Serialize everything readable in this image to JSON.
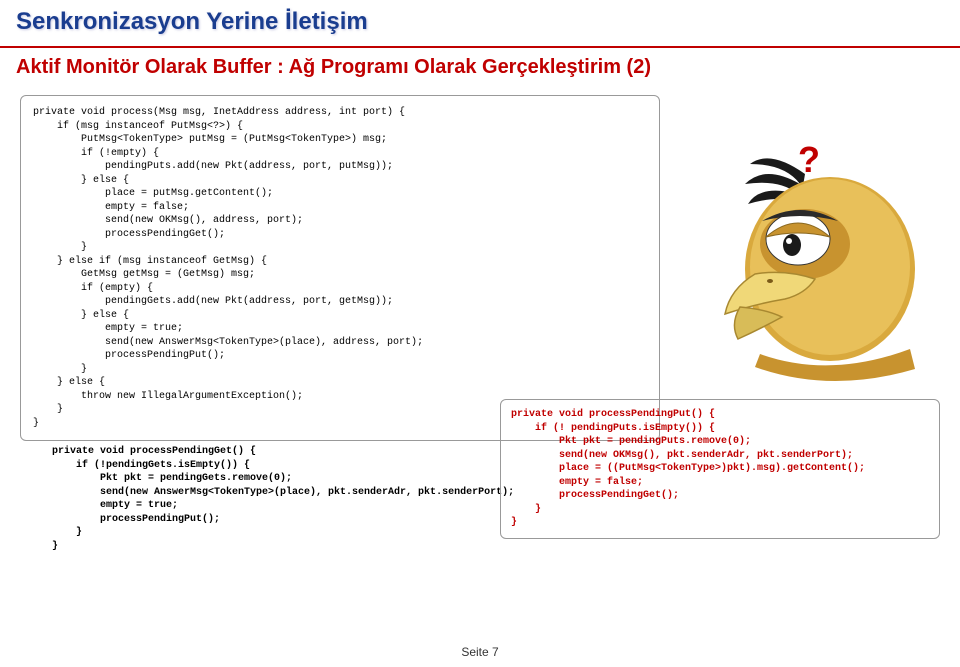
{
  "header": {
    "title": "Senkronizasyon Yerine İletişim",
    "subtitle": "Aktif Monitör Olarak Buffer : Ağ Programı Olarak Gerçekleştirim (2)"
  },
  "code": {
    "process": "private void process(Msg msg, InetAddress address, int port) {\n    if (msg instanceof PutMsg<?>) {\n        PutMsg<TokenType> putMsg = (PutMsg<TokenType>) msg;\n        if (!empty) {\n            pendingPuts.add(new Pkt(address, port, putMsg));\n        } else {\n            place = putMsg.getContent();\n            empty = false;\n            send(new OKMsg(), address, port);\n            processPendingGet();\n        }\n    } else if (msg instanceof GetMsg) {\n        GetMsg getMsg = (GetMsg) msg;\n        if (empty) {\n            pendingGets.add(new Pkt(address, port, getMsg));\n        } else {\n            empty = true;\n            send(new AnswerMsg<TokenType>(place), address, port);\n            processPendingPut();\n        }\n    } else {\n        throw new IllegalArgumentException();\n    }\n}",
    "pendingPut": "private void processPendingPut() {\n    if (! pendingPuts.isEmpty()) {\n        Pkt pkt = pendingPuts.remove(0);\n        send(new OKMsg(), pkt.senderAdr, pkt.senderPort);\n        place = ((PutMsg<TokenType>)pkt).msg).getContent();\n        empty = false;\n        processPendingGet();\n    }\n}",
    "pendingGet": "private void processPendingGet() {\n    if (!pendingGets.isEmpty()) {\n        Pkt pkt = pendingGets.remove(0);\n        send(new AnswerMsg<TokenType>(place), pkt.senderAdr, pkt.senderPort);\n        empty = true;\n        processPendingPut();\n    }\n}"
  },
  "callout": {
    "symbol": "?"
  },
  "footer": {
    "page": "Seite 7"
  }
}
